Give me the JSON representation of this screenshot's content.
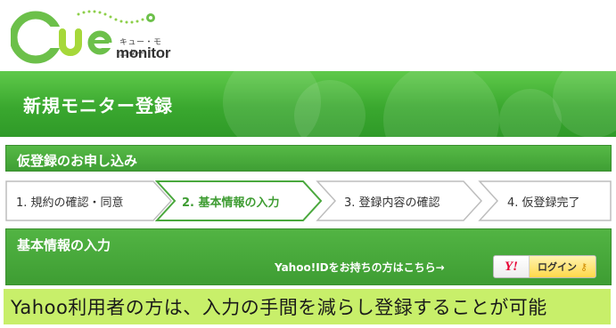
{
  "logo": {
    "kana": "キュー・モニター",
    "word": "monitor",
    "colors": {
      "green": "#5fbf3c",
      "lime": "#a6d83a"
    }
  },
  "banner": {
    "title": "新規モニター登録"
  },
  "section": {
    "title": "仮登録のお申し込み"
  },
  "steps": [
    {
      "label": "1. 規約の確認・同意",
      "active": false
    },
    {
      "label": "2. 基本情報の入力",
      "active": true
    },
    {
      "label": "3. 登録内容の確認",
      "active": false
    },
    {
      "label": "4. 仮登録完了",
      "active": false
    }
  ],
  "basic_info": {
    "title": "基本情報の入力",
    "yahoo_prompt": "Yahoo!IDをお持ちの方はこちら→",
    "yahoo_button": {
      "logo": "Y!",
      "label": "ログイン",
      "icon": "key-icon"
    }
  },
  "caption": "Yahoo利用者の方は、入力の手間を減らし登録することが可能",
  "colors": {
    "green": "#3f9f34",
    "active_step": "#3e9c32",
    "caption_bg": "#c8ef6a",
    "yahoo_red": "#e60033"
  }
}
